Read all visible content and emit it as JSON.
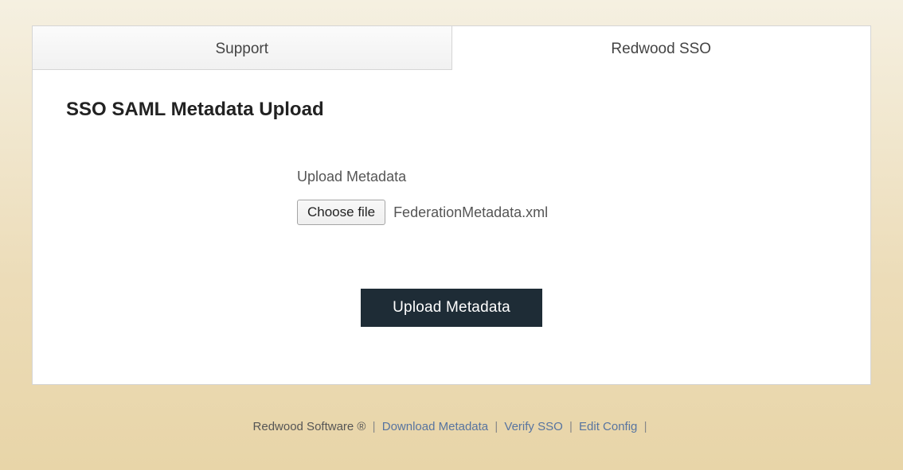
{
  "tabs": {
    "support": "Support",
    "redwood_sso": "Redwood SSO"
  },
  "page": {
    "title": "SSO SAML Metadata Upload",
    "upload_label": "Upload Metadata",
    "choose_file_label": "Choose file",
    "selected_filename": "FederationMetadata.xml",
    "submit_label": "Upload Metadata"
  },
  "footer": {
    "brand": "Redwood Software ® ",
    "sep": "|",
    "download_metadata": "Download Metadata",
    "verify_sso": "Verify SSO",
    "edit_config": "Edit Config"
  }
}
